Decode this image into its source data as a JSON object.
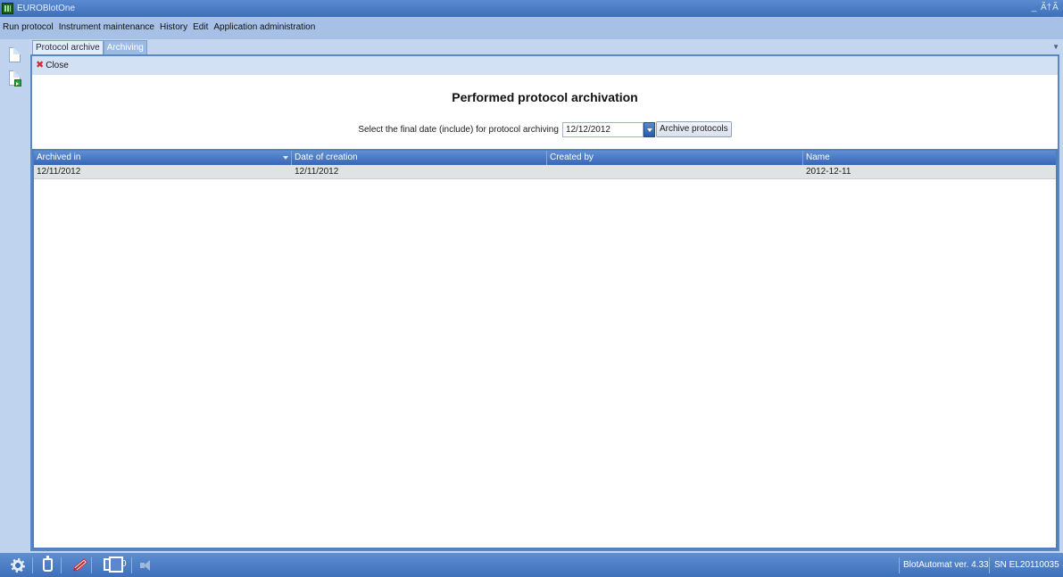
{
  "window": {
    "title": "EUROBlotOne",
    "minimize_glyph": "_",
    "restore_glyph": "Ã†",
    "close_glyph": "Ã—"
  },
  "menu": {
    "items": [
      {
        "label": "Run protocol"
      },
      {
        "label": "Instrument maintenance"
      },
      {
        "label": "History"
      },
      {
        "label": "Edit"
      },
      {
        "label": "Application administration"
      }
    ]
  },
  "tabs": [
    {
      "label": "Protocol archive",
      "active": false
    },
    {
      "label": "Archiving",
      "active": true
    }
  ],
  "left_toolbar": [
    {
      "icon": "new-document-icon"
    },
    {
      "icon": "export-document-icon"
    }
  ],
  "panel": {
    "close_label": "Close",
    "heading": "Performed protocol archivation",
    "filter_label": "Select the final date (include) for protocol archiving",
    "date_value": "12/12/2012",
    "archive_button": "Archive protocols"
  },
  "grid": {
    "columns": [
      {
        "label": "Archived in",
        "sorted": true
      },
      {
        "label": "Date of creation",
        "sorted": false
      },
      {
        "label": "Created by",
        "sorted": false
      },
      {
        "label": "Name",
        "sorted": false
      }
    ],
    "rows": [
      {
        "archived_in": "12/11/2012",
        "date_of_creation": "12/11/2012",
        "created_by": "",
        "name": "2012-12-11"
      }
    ]
  },
  "status": {
    "icons": [
      "settings-icon",
      "bottle-icon",
      "pipette-icon",
      "plates-icon",
      "speaker-icon"
    ],
    "plates_count": "0",
    "version": "BlotAutomat ver. 4.33",
    "serial": "SN EL20110035"
  },
  "colors": {
    "titlebar": "#3f6fb8",
    "menubar": "#a7c1e6",
    "grid_header": "#3966b4",
    "close_icon": "#d12f2f"
  }
}
